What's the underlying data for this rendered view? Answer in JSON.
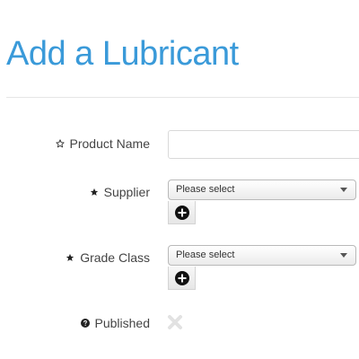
{
  "page": {
    "title": "Add a Lubricant"
  },
  "form": {
    "product_name": {
      "label": "Product Name",
      "value": "",
      "placeholder": "",
      "icon": "star-outline-icon"
    },
    "supplier": {
      "label": "Supplier",
      "selected": "Please select",
      "icon": "star-icon",
      "add_icon": "plus-circle-icon"
    },
    "grade_class": {
      "label": "Grade Class",
      "selected": "Please select",
      "icon": "star-icon",
      "add_icon": "plus-circle-icon"
    },
    "published": {
      "label": "Published",
      "icon": "question-circle-icon",
      "state_icon": "x-icon"
    }
  },
  "colors": {
    "title": "#3a9ad9",
    "divider": "#e6e6e6",
    "toggle_x": "#e2e2e2"
  }
}
